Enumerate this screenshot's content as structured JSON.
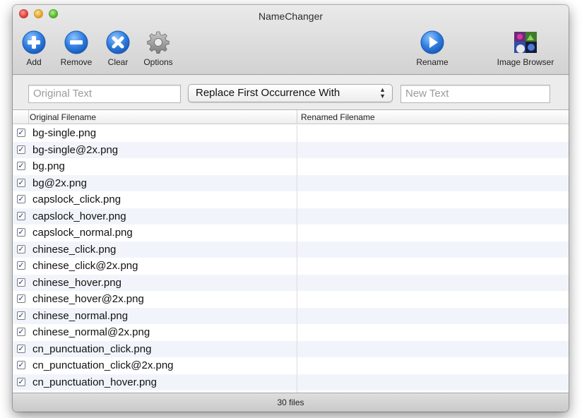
{
  "window": {
    "title": "NameChanger"
  },
  "toolbar": {
    "add": {
      "label": "Add",
      "icon": "plus-circle-icon"
    },
    "remove": {
      "label": "Remove",
      "icon": "minus-circle-icon"
    },
    "clear": {
      "label": "Clear",
      "icon": "x-circle-icon"
    },
    "options": {
      "label": "Options",
      "icon": "gear-icon"
    },
    "rename": {
      "label": "Rename",
      "icon": "play-circle-icon"
    },
    "image_browser": {
      "label": "Image Browser",
      "icon": "image-browser-icon"
    }
  },
  "controls": {
    "original_text_placeholder": "Original Text",
    "mode_selected": "Replace First Occurrence With",
    "new_text_placeholder": "New Text"
  },
  "table": {
    "columns": [
      "Original Filename",
      "Renamed Filename"
    ],
    "rows": [
      {
        "checked": true,
        "original": "bg-single.png",
        "renamed": ""
      },
      {
        "checked": true,
        "original": "bg-single@2x.png",
        "renamed": ""
      },
      {
        "checked": true,
        "original": "bg.png",
        "renamed": ""
      },
      {
        "checked": true,
        "original": "bg@2x.png",
        "renamed": ""
      },
      {
        "checked": true,
        "original": "capslock_click.png",
        "renamed": ""
      },
      {
        "checked": true,
        "original": "capslock_hover.png",
        "renamed": ""
      },
      {
        "checked": true,
        "original": "capslock_normal.png",
        "renamed": ""
      },
      {
        "checked": true,
        "original": "chinese_click.png",
        "renamed": ""
      },
      {
        "checked": true,
        "original": "chinese_click@2x.png",
        "renamed": ""
      },
      {
        "checked": true,
        "original": "chinese_hover.png",
        "renamed": ""
      },
      {
        "checked": true,
        "original": "chinese_hover@2x.png",
        "renamed": ""
      },
      {
        "checked": true,
        "original": "chinese_normal.png",
        "renamed": ""
      },
      {
        "checked": true,
        "original": "chinese_normal@2x.png",
        "renamed": ""
      },
      {
        "checked": true,
        "original": "cn_punctuation_click.png",
        "renamed": ""
      },
      {
        "checked": true,
        "original": "cn_punctuation_click@2x.png",
        "renamed": ""
      },
      {
        "checked": true,
        "original": "cn_punctuation_hover.png",
        "renamed": ""
      }
    ]
  },
  "status": {
    "text": "30 files"
  },
  "colors": {
    "accent_blue": "#2f7fe0",
    "row_alt": "#f1f5fb"
  }
}
